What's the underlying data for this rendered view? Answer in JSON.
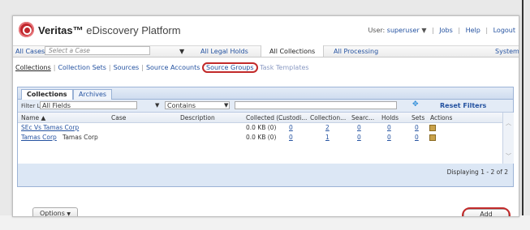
{
  "app": {
    "brand": "Veritas™",
    "product": "eDiscovery Platform"
  },
  "header": {
    "user_label": "User:",
    "user_name": "superuser",
    "user_caret": "▼",
    "links": [
      "Jobs",
      "Help",
      "Logout"
    ]
  },
  "nav": {
    "all_cases": "All Cases",
    "case_placeholder": "Select a Case",
    "all_legal_holds": "All Legal Holds",
    "all_collections": "All Collections",
    "all_processing": "All Processing",
    "system": "System"
  },
  "subnav": {
    "items": [
      "Collections",
      "Collection Sets",
      "Sources",
      "Source Accounts",
      "Source Groups",
      "Task Templates"
    ],
    "current": "Collections",
    "highlighted": "Source Groups"
  },
  "tabs": [
    "Collections",
    "Archives"
  ],
  "filter": {
    "label": "Filter List",
    "field_value": "All Fields",
    "operator_value": "Contains",
    "text_value": "",
    "reset_label": "Reset Filters"
  },
  "grid": {
    "columns": [
      "Name",
      "Case",
      "Description",
      "Collected (...",
      "Custodi...",
      "Collection...",
      "Searc...",
      "Holds",
      "Sets",
      "Actions"
    ],
    "sort_indicator": "▲",
    "rows": [
      {
        "name": "SEc Vs Tamas Corp",
        "case": "",
        "description": "",
        "collected": "0.0 KB (0)",
        "custodians": "0",
        "collections": "2",
        "searches": "0",
        "holds": "0",
        "sets": "0"
      },
      {
        "name": "Tamas Corp",
        "case": "Tamas Corp",
        "description": "",
        "collected": "0.0 KB (0)",
        "custodians": "0",
        "collections": "1",
        "searches": "0",
        "holds": "0",
        "sets": "0"
      }
    ]
  },
  "pager": {
    "text": "Displaying 1 - 2 of 2"
  },
  "buttons": {
    "options": "Options",
    "options_caret": "▼",
    "add": "Add"
  },
  "colors": {
    "accent": "#2452a0",
    "highlight_ring": "#c22a2a",
    "panel_bg": "#dce7f5"
  }
}
